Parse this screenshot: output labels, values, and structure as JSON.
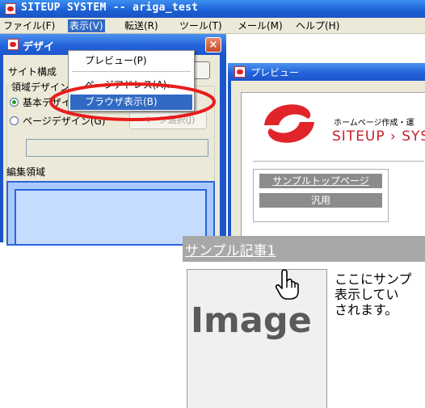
{
  "window": {
    "title": "SITEUP SYSTEM -- ariga_test"
  },
  "menubar": {
    "items": [
      {
        "label": "ファイル(F)"
      },
      {
        "label": "表示(V)"
      },
      {
        "label": "転送(R)"
      },
      {
        "label": "ツール(T)"
      },
      {
        "label": "メール(M)"
      },
      {
        "label": "ヘルプ(H)"
      }
    ]
  },
  "view_menu": {
    "items": [
      {
        "label": "プレビュー(P)"
      },
      {
        "label": "ページアドレス(A)..."
      },
      {
        "label": "ブラウザ表示(B)"
      }
    ]
  },
  "design_window": {
    "title": "デザイ",
    "close_label": "×",
    "site_label": "サイト構成",
    "site_button": "...)",
    "group_label": "領域デザイン",
    "radio_basic": "基本デザイン(B)",
    "radio_page": "ページデザイン(G)",
    "page_select": "ページ選択(J)",
    "edit_area_label": "編集領域"
  },
  "preview_window": {
    "title": "プレビュー",
    "header_tagline": "ホームページ作成・運",
    "brand": "SITEUP › SYS",
    "nav_top": "サンプルトップページ",
    "nav_general": "汎用"
  },
  "zoomed": {
    "link": "サンプル記事1",
    "image_label": "Image",
    "body_lines": [
      "ここにサンプ",
      "表示してい",
      "されます。"
    ]
  },
  "colors": {
    "accent": "#316ac5",
    "title_bar": "#1c5fd6",
    "highlight_ellipse": "#e81c1c",
    "logo_red": "#e0252a",
    "brand_text": "#c8202a"
  }
}
